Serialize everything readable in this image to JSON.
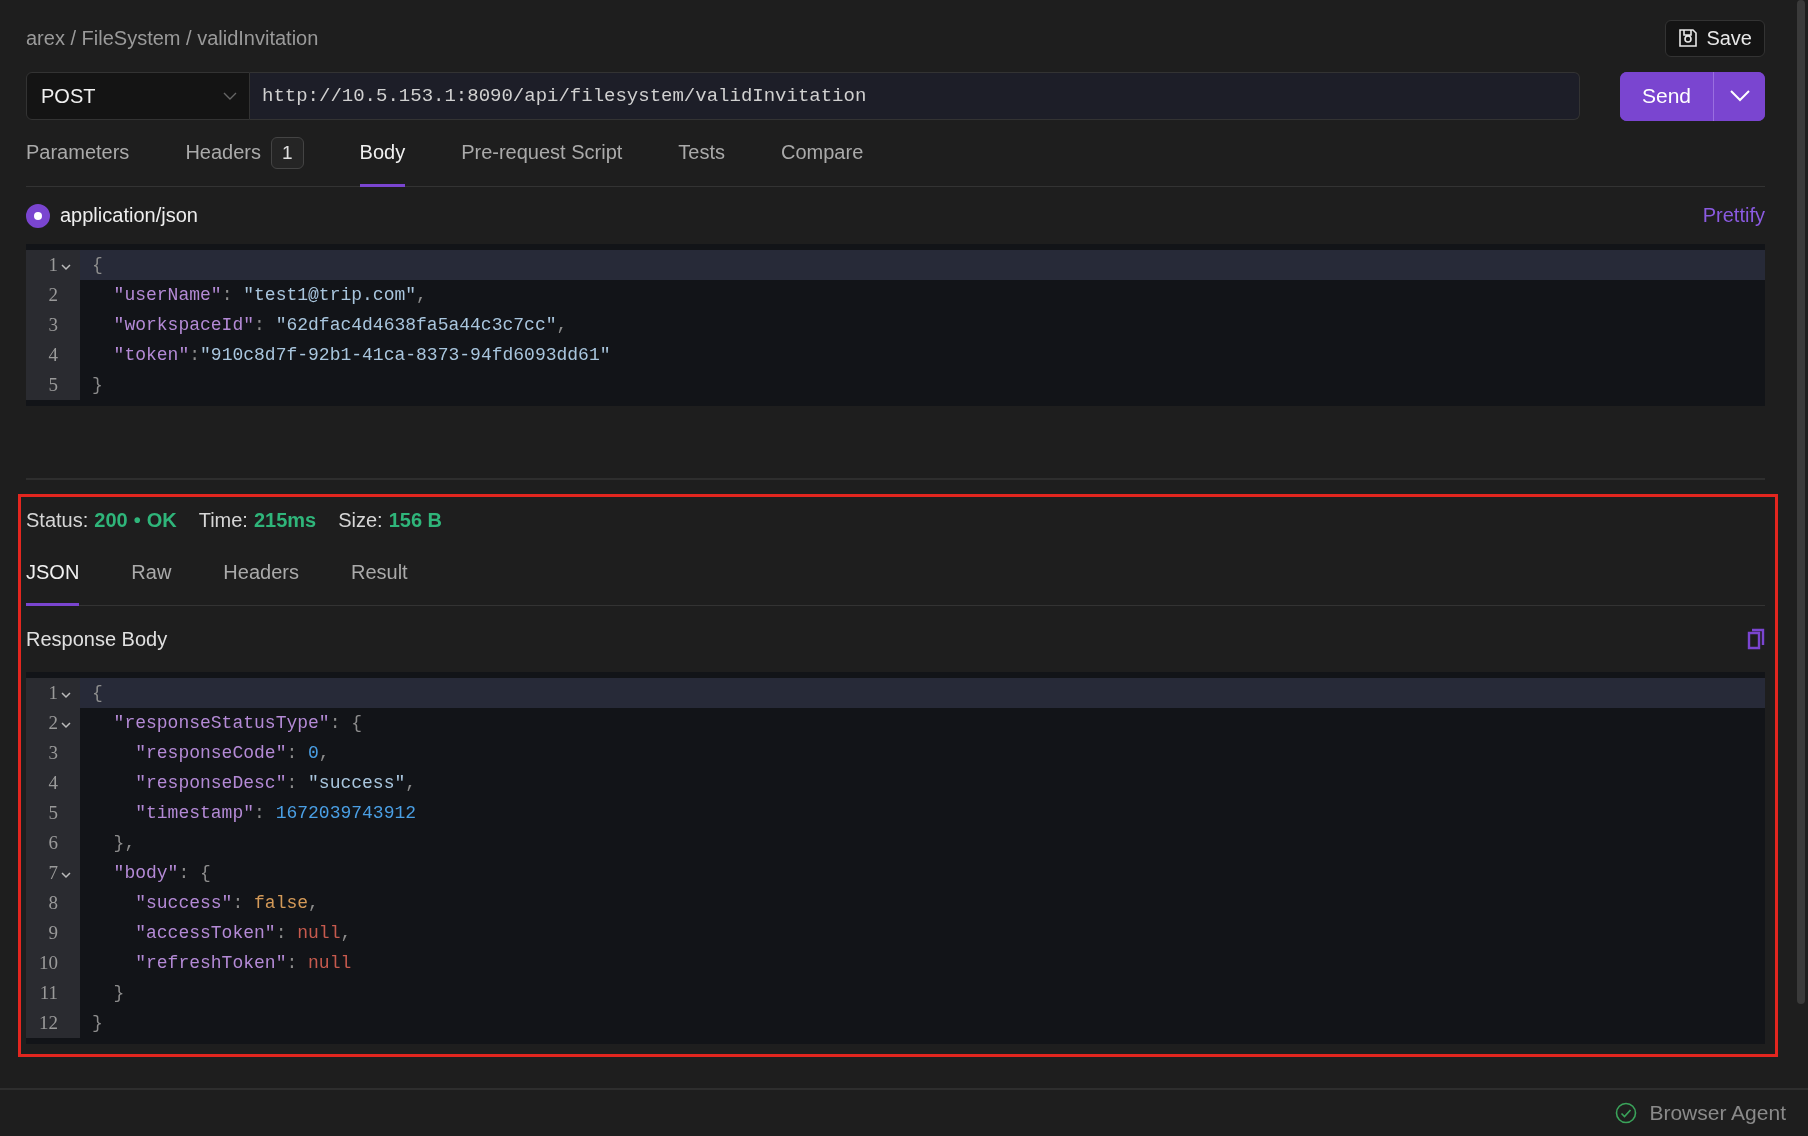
{
  "breadcrumb": "arex / FileSystem / validInvitation",
  "save_button": {
    "label": "Save"
  },
  "request": {
    "method": "POST",
    "url": "http://10.5.153.1:8090/api/filesystem/validInvitation",
    "send_label": "Send"
  },
  "request_tabs": [
    {
      "label": "Parameters",
      "selected": false
    },
    {
      "label": "Headers",
      "badge": "1",
      "selected": false
    },
    {
      "label": "Body",
      "selected": true
    },
    {
      "label": "Pre-request Script",
      "selected": false
    },
    {
      "label": "Tests",
      "selected": false
    },
    {
      "label": "Compare",
      "selected": false
    }
  ],
  "content_type": {
    "label": "application/json",
    "selected": true
  },
  "prettify": "Prettify",
  "request_body": [
    {
      "number": "1",
      "fold": true,
      "highlighted": true,
      "tokens": [
        {
          "kind": "punct",
          "text": "{"
        }
      ]
    },
    {
      "number": "2",
      "fold": false,
      "highlighted": false,
      "tokens": [
        {
          "kind": "key",
          "text": "  \"userName\""
        },
        {
          "kind": "punct",
          "text": ": "
        },
        {
          "kind": "string",
          "text": "\"test1@trip.com\""
        },
        {
          "kind": "punct",
          "text": ","
        }
      ]
    },
    {
      "number": "3",
      "fold": false,
      "highlighted": false,
      "tokens": [
        {
          "kind": "key",
          "text": "  \"workspaceId\""
        },
        {
          "kind": "punct",
          "text": ": "
        },
        {
          "kind": "string",
          "text": "\"62dfac4d4638fa5a44c3c7cc\""
        },
        {
          "kind": "punct",
          "text": ","
        }
      ]
    },
    {
      "number": "4",
      "fold": false,
      "highlighted": false,
      "tokens": [
        {
          "kind": "key",
          "text": "  \"token\""
        },
        {
          "kind": "punct",
          "text": ":"
        },
        {
          "kind": "string",
          "text": "\"910c8d7f-92b1-41ca-8373-94fd6093dd61\""
        }
      ]
    },
    {
      "number": "5",
      "fold": false,
      "highlighted": false,
      "tokens": [
        {
          "kind": "punct",
          "text": "}"
        }
      ]
    }
  ],
  "response": {
    "status": {
      "label": "Status:",
      "code": "200",
      "separator": "•",
      "message": "OK"
    },
    "time": {
      "label": "Time:",
      "value": "215ms"
    },
    "size": {
      "label": "Size:",
      "value": "156 B"
    },
    "tabs": [
      {
        "label": "JSON",
        "selected": true
      },
      {
        "label": "Raw",
        "selected": false
      },
      {
        "label": "Headers",
        "selected": false
      },
      {
        "label": "Result",
        "selected": false
      }
    ],
    "body_title": "Response Body",
    "body": [
      {
        "number": "1",
        "fold": true,
        "highlighted": true,
        "tokens": [
          {
            "kind": "punct",
            "text": "{"
          }
        ]
      },
      {
        "number": "2",
        "fold": true,
        "highlighted": false,
        "tokens": [
          {
            "kind": "key",
            "text": "  \"responseStatusType\""
          },
          {
            "kind": "punct",
            "text": ": {"
          }
        ]
      },
      {
        "number": "3",
        "fold": false,
        "highlighted": false,
        "tokens": [
          {
            "kind": "key",
            "text": "    \"responseCode\""
          },
          {
            "kind": "punct",
            "text": ": "
          },
          {
            "kind": "number",
            "text": "0"
          },
          {
            "kind": "punct",
            "text": ","
          }
        ]
      },
      {
        "number": "4",
        "fold": false,
        "highlighted": false,
        "tokens": [
          {
            "kind": "key",
            "text": "    \"responseDesc\""
          },
          {
            "kind": "punct",
            "text": ": "
          },
          {
            "kind": "string",
            "text": "\"success\""
          },
          {
            "kind": "punct",
            "text": ","
          }
        ]
      },
      {
        "number": "5",
        "fold": false,
        "highlighted": false,
        "tokens": [
          {
            "kind": "key",
            "text": "    \"timestamp\""
          },
          {
            "kind": "punct",
            "text": ": "
          },
          {
            "kind": "number",
            "text": "1672039743912"
          }
        ]
      },
      {
        "number": "6",
        "fold": false,
        "highlighted": false,
        "tokens": [
          {
            "kind": "punct",
            "text": "  },"
          }
        ]
      },
      {
        "number": "7",
        "fold": true,
        "highlighted": false,
        "tokens": [
          {
            "kind": "key",
            "text": "  \"body\""
          },
          {
            "kind": "punct",
            "text": ": {"
          }
        ]
      },
      {
        "number": "8",
        "fold": false,
        "highlighted": false,
        "tokens": [
          {
            "kind": "key",
            "text": "    \"success\""
          },
          {
            "kind": "punct",
            "text": ": "
          },
          {
            "kind": "boolean",
            "text": "false"
          },
          {
            "kind": "punct",
            "text": ","
          }
        ]
      },
      {
        "number": "9",
        "fold": false,
        "highlighted": false,
        "tokens": [
          {
            "kind": "key",
            "text": "    \"accessToken\""
          },
          {
            "kind": "punct",
            "text": ": "
          },
          {
            "kind": "null",
            "text": "null"
          },
          {
            "kind": "punct",
            "text": ","
          }
        ]
      },
      {
        "number": "10",
        "fold": false,
        "highlighted": false,
        "tokens": [
          {
            "kind": "key",
            "text": "    \"refreshToken\""
          },
          {
            "kind": "punct",
            "text": ": "
          },
          {
            "kind": "null",
            "text": "null"
          }
        ]
      },
      {
        "number": "11",
        "fold": false,
        "highlighted": false,
        "tokens": [
          {
            "kind": "punct",
            "text": "  }"
          }
        ]
      },
      {
        "number": "12",
        "fold": false,
        "highlighted": false,
        "tokens": [
          {
            "kind": "punct",
            "text": "}"
          }
        ]
      }
    ]
  },
  "status_bar": {
    "agent": "Browser Agent"
  }
}
